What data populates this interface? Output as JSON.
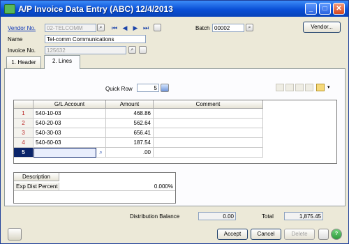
{
  "window": {
    "title": "A/P Invoice Data Entry (ABC) 12/4/2013",
    "minimize": "_",
    "maximize": "□",
    "close": "✕"
  },
  "header": {
    "vendor_label": "Vendor No.",
    "vendor_value": "02-TELCOMM",
    "name_label": "Name",
    "name_value": "Tel-comm Communications",
    "invoice_label": "Invoice No.",
    "invoice_value": "125632",
    "batch_label": "Batch",
    "batch_value": "00002",
    "vendor_button": "Vendor..."
  },
  "tabs": [
    {
      "label": "1. Header",
      "active": false
    },
    {
      "label": "2. Lines",
      "active": true
    }
  ],
  "lines": {
    "quick_row_label": "Quick Row",
    "quick_row_value": "5",
    "columns": [
      "G/L Account",
      "Amount",
      "Comment"
    ],
    "rows": [
      {
        "num": "1",
        "account": "540-10-03",
        "amount": "468.86",
        "comment": ""
      },
      {
        "num": "2",
        "account": "540-20-03",
        "amount": "562.64",
        "comment": ""
      },
      {
        "num": "3",
        "account": "540-30-03",
        "amount": "656.41",
        "comment": ""
      },
      {
        "num": "4",
        "account": "540-60-03",
        "amount": "187.54",
        "comment": ""
      },
      {
        "num": "5",
        "account": "",
        "amount": ".00",
        "comment": ""
      }
    ]
  },
  "description_grid": {
    "header": "Description",
    "row_label": "Exp Dist Percent",
    "row_value": "0.000%"
  },
  "footer": {
    "distribution_balance_label": "Distribution Balance",
    "distribution_balance_value": "0.00",
    "total_label": "Total",
    "total_value": "1,875.45",
    "accept": "Accept",
    "cancel": "Cancel",
    "delete": "Delete",
    "help": "?"
  },
  "colors": {
    "title_bar": "#0a4fd6",
    "window_bg": "#ece9d8",
    "current_row": "#0a246a",
    "row_number_text": "#b61c1c"
  }
}
